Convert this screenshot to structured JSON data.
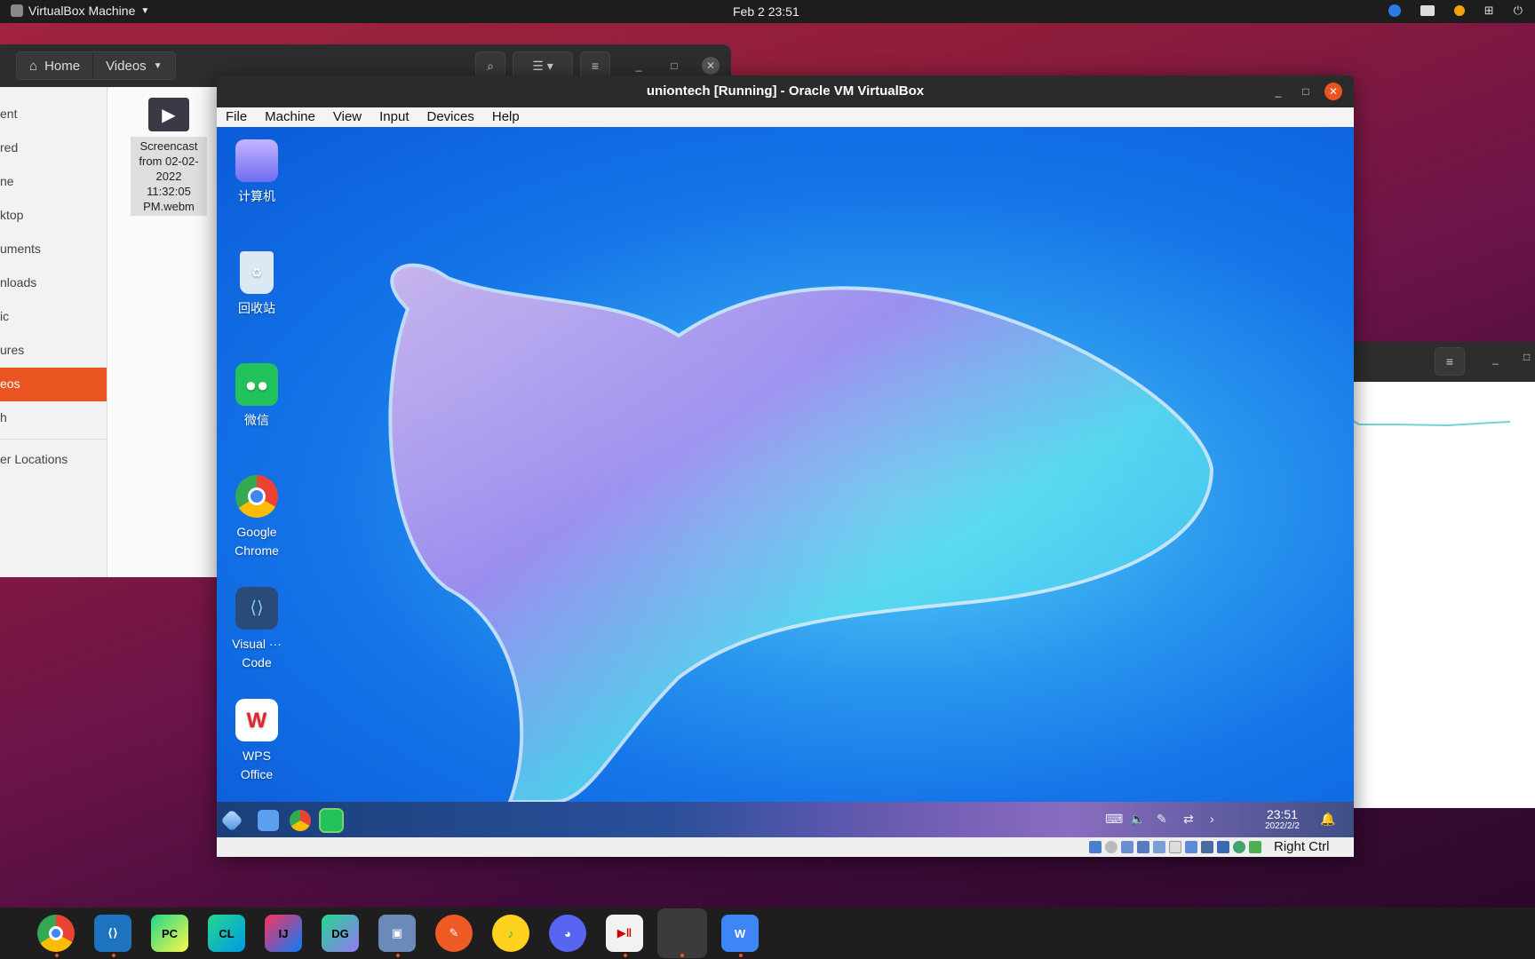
{
  "topbar": {
    "app_name": "VirtualBox Machine",
    "clock": "Feb 2  23:51"
  },
  "file_manager": {
    "breadcrumbs": [
      "Home",
      "Videos"
    ],
    "sidebar": [
      "ent",
      "red",
      "ne",
      "ktop",
      "uments",
      "nloads",
      "ic",
      "ures",
      "eos",
      "h",
      "er Locations"
    ],
    "active_index": 8,
    "file": {
      "icon": "video-file-icon",
      "name_lines": [
        "Screencast",
        "from 02-02-",
        "2022",
        "11:32:05",
        "PM.webm"
      ]
    }
  },
  "vbox": {
    "title": "uniontech [Running] - Oracle VM VirtualBox",
    "menu": [
      "File",
      "Machine",
      "View",
      "Input",
      "Devices",
      "Help"
    ],
    "status_host_key": "Right Ctrl"
  },
  "guest": {
    "desktop_icons": [
      {
        "label": "计算机",
        "icon": "computer-icon",
        "color": "#8a6cff"
      },
      {
        "label": "回收站",
        "icon": "trash-icon",
        "color": "#dce8f4"
      },
      {
        "label": "微信",
        "icon": "wechat-icon",
        "color": "#21c25a"
      },
      {
        "label": "Google Chrome",
        "icon": "chrome-icon",
        "color": "#ffffff"
      },
      {
        "label": "Visual ··· Code",
        "icon": "vscode-icon",
        "color": "#2a4b7a"
      },
      {
        "label": "WPS Office",
        "icon": "wps-icon",
        "color": "#ffffff"
      }
    ],
    "taskbar": {
      "time": "23:51",
      "date": "2022/2/2"
    }
  },
  "dock": {
    "apps": [
      {
        "name": "chrome",
        "label": ""
      },
      {
        "name": "vscode",
        "label": ""
      },
      {
        "name": "pycharm",
        "label": "PC"
      },
      {
        "name": "clion",
        "label": "CL"
      },
      {
        "name": "intellij",
        "label": "IJ"
      },
      {
        "name": "datagrip",
        "label": "DG"
      },
      {
        "name": "virtualbox",
        "label": ""
      },
      {
        "name": "postman",
        "label": ""
      },
      {
        "name": "qqmusic",
        "label": ""
      },
      {
        "name": "discord",
        "label": ""
      },
      {
        "name": "screen-recorder",
        "label": ""
      },
      {
        "name": "blank-app",
        "label": ""
      },
      {
        "name": "wps",
        "label": "W"
      }
    ]
  },
  "colors": {
    "accent": "#e95420",
    "guest_blue": "#1474e8"
  }
}
